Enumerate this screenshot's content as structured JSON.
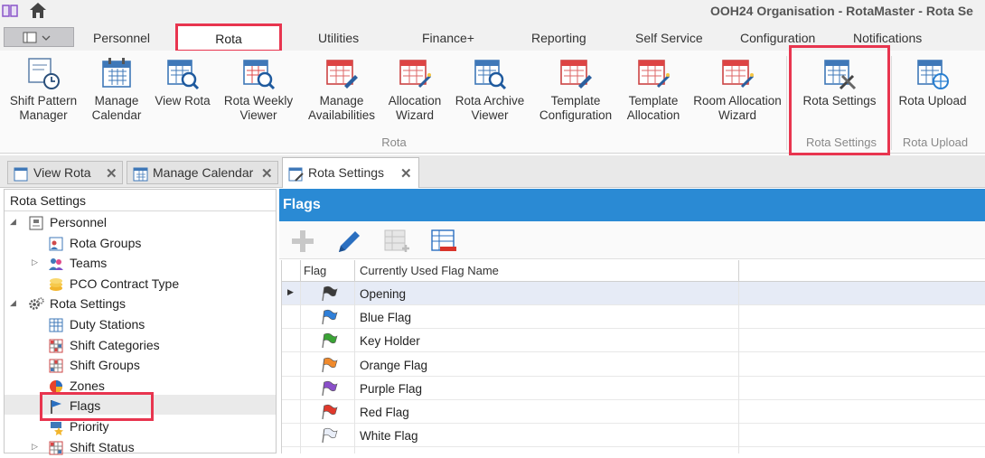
{
  "window": {
    "title": "OOH24 Organisation - RotaMaster - Rota Se"
  },
  "ribbon_tabs": [
    "Personnel",
    "Rota",
    "Utilities",
    "Finance+",
    "Reporting",
    "Self Service",
    "Configuration",
    "Notifications"
  ],
  "active_ribbon_tab": "Rota",
  "ribbon": {
    "buttons": [
      {
        "label": "Shift Pattern Manager",
        "icon": "shift-pattern-icon"
      },
      {
        "label": "Manage Calendar",
        "icon": "calendar-icon"
      },
      {
        "label": "View Rota",
        "icon": "view-rota-icon"
      },
      {
        "label": "Rota Weekly Viewer",
        "icon": "weekly-viewer-icon"
      },
      {
        "label": "Manage Availabilities",
        "icon": "availabilities-icon"
      },
      {
        "label": "Allocation Wizard",
        "icon": "allocation-wizard-icon"
      },
      {
        "label": "Rota Archive Viewer",
        "icon": "archive-viewer-icon"
      },
      {
        "label": "Template Configuration",
        "icon": "template-config-icon"
      },
      {
        "label": "Template Allocation",
        "icon": "template-allocation-icon"
      },
      {
        "label": "Room Allocation Wizard",
        "icon": "room-allocation-icon"
      },
      {
        "label": "Rota Settings",
        "icon": "rota-settings-icon"
      },
      {
        "label": "Rota Upload",
        "icon": "rota-upload-icon"
      }
    ],
    "groups": [
      "Rota",
      "Rota Settings",
      "Rota Upload"
    ]
  },
  "doc_tabs": [
    {
      "label": "View Rota",
      "active": false
    },
    {
      "label": "Manage Calendar",
      "active": false
    },
    {
      "label": "Rota Settings",
      "active": true
    }
  ],
  "tree": {
    "title": "Rota Settings",
    "nodes": [
      {
        "label": "Personnel",
        "level": 0,
        "expander": "expanded",
        "icon": "personnel-icon"
      },
      {
        "label": "Rota Groups",
        "level": 1,
        "expander": "none",
        "icon": "rota-groups-icon"
      },
      {
        "label": "Teams",
        "level": 1,
        "expander": "collapsed",
        "icon": "teams-icon"
      },
      {
        "label": "PCO Contract Type",
        "level": 1,
        "expander": "none",
        "icon": "coins-icon"
      },
      {
        "label": "Rota Settings",
        "level": 0,
        "expander": "expanded",
        "icon": "gears-icon"
      },
      {
        "label": "Duty Stations",
        "level": 1,
        "expander": "none",
        "icon": "duty-stations-icon"
      },
      {
        "label": "Shift Categories",
        "level": 1,
        "expander": "none",
        "icon": "shift-categories-icon"
      },
      {
        "label": "Shift Groups",
        "level": 1,
        "expander": "none",
        "icon": "shift-groups-icon"
      },
      {
        "label": "Zones",
        "level": 1,
        "expander": "none",
        "icon": "zones-icon"
      },
      {
        "label": "Flags",
        "level": 1,
        "expander": "none",
        "icon": "flag-icon"
      },
      {
        "label": "Priority",
        "level": 1,
        "expander": "none",
        "icon": "priority-icon"
      },
      {
        "label": "Shift Status",
        "level": 1,
        "expander": "collapsed",
        "icon": "shift-status-icon"
      }
    ],
    "selected": "Flags"
  },
  "flags_panel": {
    "title": "Flags",
    "toolbar": [
      "add-icon",
      "edit-icon",
      "add-row-icon",
      "delete-row-icon"
    ],
    "columns": [
      "Flag",
      "Currently Used Flag Name"
    ],
    "rows": [
      {
        "name": "Opening",
        "color": "#3a3a3a",
        "selected": true
      },
      {
        "name": "Blue Flag",
        "color": "#2f7fd8",
        "selected": false
      },
      {
        "name": "Key Holder",
        "color": "#3aa335",
        "selected": false
      },
      {
        "name": "Orange Flag",
        "color": "#f08a2c",
        "selected": false
      },
      {
        "name": "Purple Flag",
        "color": "#8a4fc9",
        "selected": false
      },
      {
        "name": "Red Flag",
        "color": "#e0392c",
        "selected": false
      },
      {
        "name": "White Flag",
        "color": "#e9eef8",
        "selected": false
      }
    ]
  },
  "colors": {
    "accent": "#2a8ad4",
    "highlight_box": "#e8354f",
    "selected_row": "#e6ebf6"
  }
}
